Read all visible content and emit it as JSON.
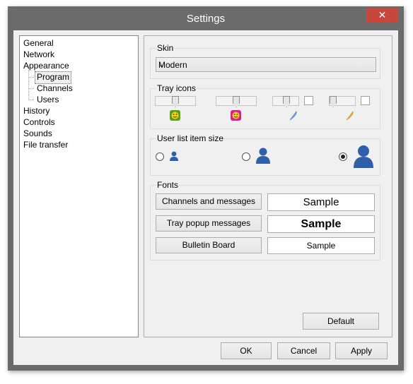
{
  "window": {
    "title": "Settings",
    "close_glyph": "✕"
  },
  "tree": {
    "items": [
      {
        "label": "General"
      },
      {
        "label": "Network"
      },
      {
        "label": "Appearance"
      },
      {
        "label": "Program"
      },
      {
        "label": "Channels"
      },
      {
        "label": "Users"
      },
      {
        "label": "History"
      },
      {
        "label": "Controls"
      },
      {
        "label": "Sounds"
      },
      {
        "label": "File transfer"
      }
    ],
    "selected": "Program"
  },
  "skin": {
    "title": "Skin",
    "value": "Modern",
    "arrow_glyph": "⌄"
  },
  "tray_icons": {
    "title": "Tray icons",
    "icons": [
      "green-smiley-icon",
      "pink-smiley-icon",
      "blue-feather-icon",
      "orange-feather-icon"
    ]
  },
  "user_list": {
    "title": "User list item size",
    "options": [
      "small",
      "medium",
      "large"
    ],
    "selected": "large"
  },
  "fonts": {
    "title": "Fonts",
    "rows": [
      {
        "button": "Channels and messages",
        "sample": "Sample"
      },
      {
        "button": "Tray popup messages",
        "sample": "Sample"
      },
      {
        "button": "Bulletin Board",
        "sample": "Sample"
      }
    ]
  },
  "buttons": {
    "default": "Default",
    "ok": "OK",
    "cancel": "Cancel",
    "apply": "Apply"
  },
  "colors": {
    "titlebar": "#6b6b6b",
    "close": "#c7473c",
    "client": "#f0f0f0",
    "green_icon": "#5aa012",
    "pink_icon": "#e0199a",
    "blue_user": "#2f5fa8"
  }
}
